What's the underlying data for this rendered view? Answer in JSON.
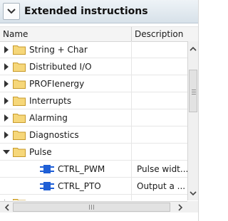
{
  "panel": {
    "title": "Extended instructions",
    "columns": {
      "name": "Name",
      "description": "Description"
    }
  },
  "tree": {
    "folders": [
      {
        "label": "String + Char"
      },
      {
        "label": "Distributed I/O"
      },
      {
        "label": "PROFIenergy"
      },
      {
        "label": "Interrupts"
      },
      {
        "label": "Alarming"
      },
      {
        "label": "Diagnostics"
      },
      {
        "label": "Pulse"
      }
    ],
    "children": [
      {
        "label": "CTRL_PWM",
        "description": "Pulse widt..."
      },
      {
        "label": "CTRL_PTO",
        "description": "Output a ..."
      }
    ]
  },
  "icons": {
    "title_toggle": "chevron-down-icon",
    "collapsed": "triangle-right-icon",
    "expanded": "triangle-down-icon",
    "folder": "folder-icon",
    "block": "function-block-icon"
  },
  "colors": {
    "folder_fill": "#f6d77a",
    "folder_stroke": "#c79a2b",
    "block_blue": "#1f5fd6",
    "title_bar": "#dbe4ec"
  }
}
